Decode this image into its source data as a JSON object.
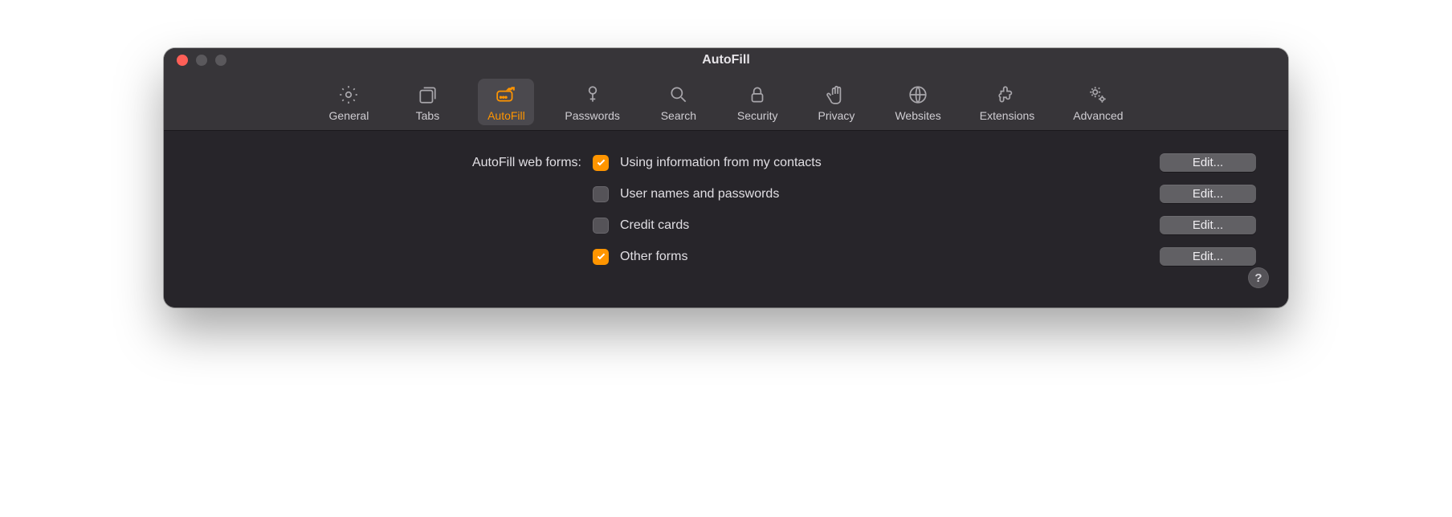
{
  "window": {
    "title": "AutoFill"
  },
  "toolbar": {
    "tabs": [
      {
        "id": "general",
        "label": "General"
      },
      {
        "id": "tabs",
        "label": "Tabs"
      },
      {
        "id": "autofill",
        "label": "AutoFill"
      },
      {
        "id": "passwords",
        "label": "Passwords"
      },
      {
        "id": "search",
        "label": "Search"
      },
      {
        "id": "security",
        "label": "Security"
      },
      {
        "id": "privacy",
        "label": "Privacy"
      },
      {
        "id": "websites",
        "label": "Websites"
      },
      {
        "id": "extensions",
        "label": "Extensions"
      },
      {
        "id": "advanced",
        "label": "Advanced"
      }
    ],
    "active_tab": "autofill"
  },
  "content": {
    "section_label": "AutoFill web forms:",
    "options": [
      {
        "id": "contacts",
        "label": "Using information from my contacts",
        "checked": true,
        "edit_label": "Edit..."
      },
      {
        "id": "usernames",
        "label": "User names and passwords",
        "checked": false,
        "edit_label": "Edit..."
      },
      {
        "id": "creditcards",
        "label": "Credit cards",
        "checked": false,
        "edit_label": "Edit..."
      },
      {
        "id": "otherforms",
        "label": "Other forms",
        "checked": true,
        "edit_label": "Edit..."
      }
    ],
    "help_label": "?"
  }
}
